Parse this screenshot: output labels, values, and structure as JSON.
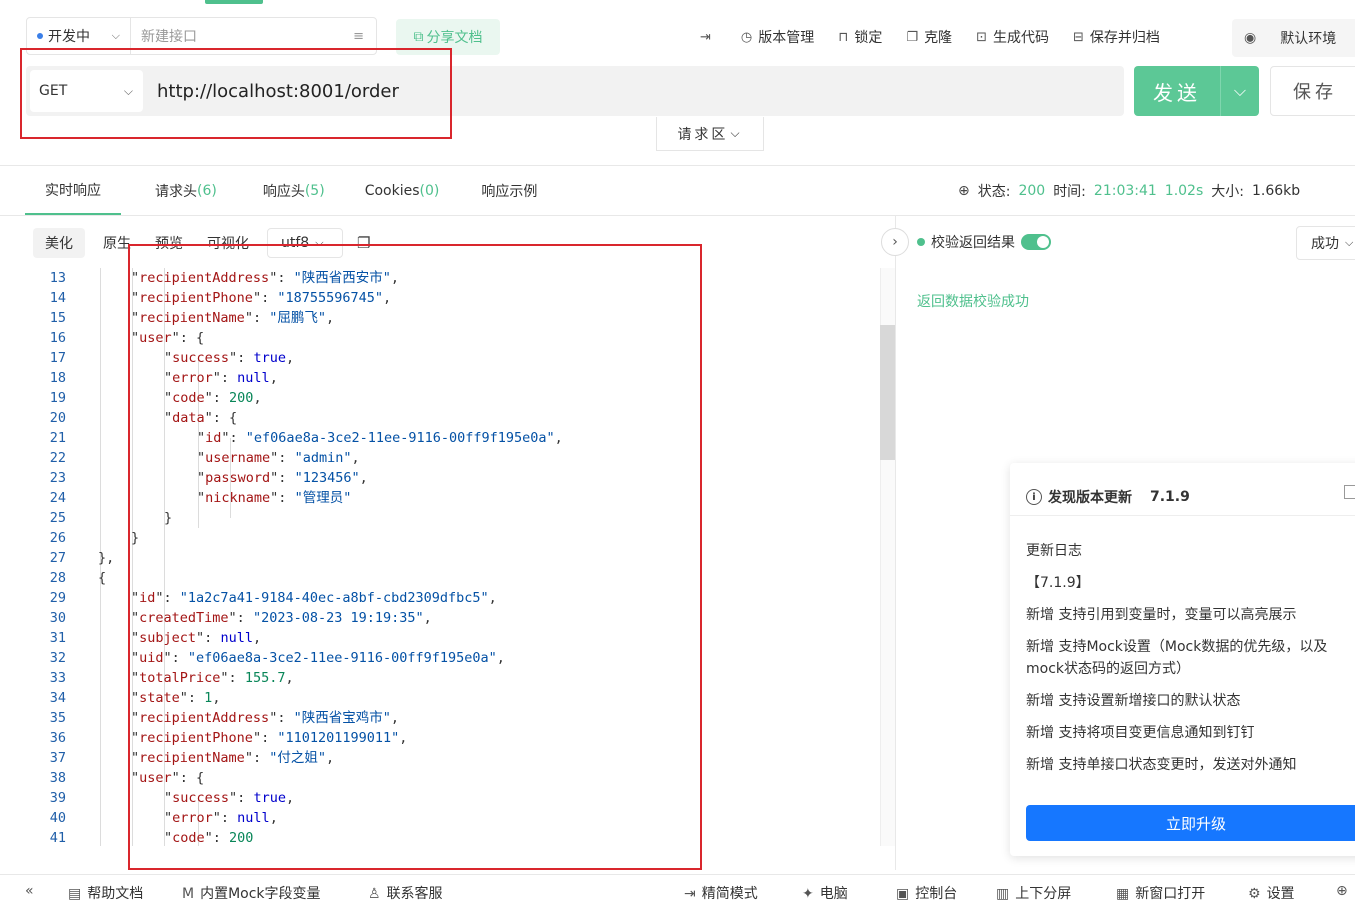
{
  "top": {
    "status": "开发中",
    "api_name_placeholder": "新建接口",
    "share": "分享文档",
    "tools": [
      {
        "icon": "indent-icon",
        "label": ""
      },
      {
        "icon": "clock-icon",
        "label": "版本管理"
      },
      {
        "icon": "lock-icon",
        "label": "锁定"
      },
      {
        "icon": "copy-icon",
        "label": "克隆"
      },
      {
        "icon": "code-icon",
        "label": "生成代码"
      },
      {
        "icon": "archive-icon",
        "label": "保存并归档"
      }
    ],
    "env": "默认环境"
  },
  "request": {
    "method": "GET",
    "url": "http://localhost:8001/order",
    "send": "发送",
    "save": "保存",
    "zone": "请求区"
  },
  "tabs": [
    {
      "label": "实时响应",
      "count": ""
    },
    {
      "label": "请求头",
      "count": "(6)"
    },
    {
      "label": "响应头",
      "count": "(5)"
    },
    {
      "label": "Cookies",
      "count": "(0)"
    },
    {
      "label": "响应示例",
      "count": ""
    }
  ],
  "status_line": {
    "status_label": "状态:",
    "status": "200",
    "time_label": "时间:",
    "time": "21:03:41",
    "duration": "1.02s",
    "size_label": "大小:",
    "size": "1.66kb"
  },
  "subtabs": [
    "美化",
    "原生",
    "预览",
    "可视化"
  ],
  "encoding": "utf8",
  "code_lines": [
    {
      "n": "13",
      "indent": 4,
      "k": "recipientAddress",
      "v": "\"陕西省西安市\"",
      "t": "s",
      "tail": ","
    },
    {
      "n": "14",
      "indent": 4,
      "k": "recipientPhone",
      "v": "\"18755596745\"",
      "t": "s",
      "tail": ","
    },
    {
      "n": "15",
      "indent": 4,
      "k": "recipientName",
      "v": "\"屈鹏飞\"",
      "t": "s",
      "tail": ","
    },
    {
      "n": "16",
      "indent": 4,
      "k": "user",
      "v": "{",
      "t": "p",
      "tail": ""
    },
    {
      "n": "17",
      "indent": 5,
      "k": "success",
      "v": "true",
      "t": "b",
      "tail": ","
    },
    {
      "n": "18",
      "indent": 5,
      "k": "error",
      "v": "null",
      "t": "b",
      "tail": ","
    },
    {
      "n": "19",
      "indent": 5,
      "k": "code",
      "v": "200",
      "t": "v",
      "tail": ","
    },
    {
      "n": "20",
      "indent": 5,
      "k": "data",
      "v": "{",
      "t": "p",
      "tail": ""
    },
    {
      "n": "21",
      "indent": 6,
      "k": "id",
      "v": "\"ef06ae8a-3ce2-11ee-9116-00ff9f195e0a\"",
      "t": "s",
      "tail": ","
    },
    {
      "n": "22",
      "indent": 6,
      "k": "username",
      "v": "\"admin\"",
      "t": "s",
      "tail": ","
    },
    {
      "n": "23",
      "indent": 6,
      "k": "password",
      "v": "\"123456\"",
      "t": "s",
      "tail": ","
    },
    {
      "n": "24",
      "indent": 6,
      "k": "nickname",
      "v": "\"管理员\"",
      "t": "s",
      "tail": ""
    },
    {
      "n": "25",
      "indent": 5,
      "k": "",
      "v": "}",
      "t": "p",
      "tail": ""
    },
    {
      "n": "26",
      "indent": 4,
      "k": "",
      "v": "}",
      "t": "p",
      "tail": ""
    },
    {
      "n": "27",
      "indent": 3,
      "k": "",
      "v": "},",
      "t": "p",
      "tail": ""
    },
    {
      "n": "28",
      "indent": 3,
      "k": "",
      "v": "{",
      "t": "p",
      "tail": ""
    },
    {
      "n": "29",
      "indent": 4,
      "k": "id",
      "v": "\"1a2c7a41-9184-40ec-a8bf-cbd2309dfbc5\"",
      "t": "s",
      "tail": ","
    },
    {
      "n": "30",
      "indent": 4,
      "k": "createdTime",
      "v": "\"2023-08-23 19:19:35\"",
      "t": "s",
      "tail": ","
    },
    {
      "n": "31",
      "indent": 4,
      "k": "subject",
      "v": "null",
      "t": "b",
      "tail": ","
    },
    {
      "n": "32",
      "indent": 4,
      "k": "uid",
      "v": "\"ef06ae8a-3ce2-11ee-9116-00ff9f195e0a\"",
      "t": "s",
      "tail": ","
    },
    {
      "n": "33",
      "indent": 4,
      "k": "totalPrice",
      "v": "155.7",
      "t": "v",
      "tail": ","
    },
    {
      "n": "34",
      "indent": 4,
      "k": "state",
      "v": "1",
      "t": "v",
      "tail": ","
    },
    {
      "n": "35",
      "indent": 4,
      "k": "recipientAddress",
      "v": "\"陕西省宝鸡市\"",
      "t": "s",
      "tail": ","
    },
    {
      "n": "36",
      "indent": 4,
      "k": "recipientPhone",
      "v": "\"1101201199011\"",
      "t": "s",
      "tail": ","
    },
    {
      "n": "37",
      "indent": 4,
      "k": "recipientName",
      "v": "\"付之姐\"",
      "t": "s",
      "tail": ","
    },
    {
      "n": "38",
      "indent": 4,
      "k": "user",
      "v": "{",
      "t": "p",
      "tail": ""
    },
    {
      "n": "39",
      "indent": 5,
      "k": "success",
      "v": "true",
      "t": "b",
      "tail": ","
    },
    {
      "n": "40",
      "indent": 5,
      "k": "error",
      "v": "null",
      "t": "b",
      "tail": ","
    },
    {
      "n": "41",
      "indent": 5,
      "k": "code",
      "v": "200",
      "t": "v",
      "tail": ""
    }
  ],
  "verify": {
    "label": "校验返回结果",
    "result": "成功",
    "message": "返回数据校验成功"
  },
  "update": {
    "title": "发现版本更新",
    "version": "7.1.9",
    "log_title": "更新日志",
    "ver_tag": "【7.1.9】",
    "items": [
      "新增 支持引用到变量时，变量可以高亮展示",
      "新增 支持Mock设置（Mock数据的优先级，以及mock状态码的返回方式）",
      "新增 支持设置新增接口的默认状态",
      "新增 支持将项目变更信息通知到钉钉",
      "新增 支持单接口状态变更时，发送对外通知"
    ],
    "button": "立即升级"
  },
  "bottom": {
    "items": [
      {
        "icon": "collapse-icon",
        "label": ""
      },
      {
        "icon": "help-icon",
        "label": "帮助文档"
      },
      {
        "icon": "mock-icon",
        "label": "内置Mock字段变量"
      },
      {
        "icon": "user-icon",
        "label": "联系客服"
      },
      {
        "icon": "compact-icon",
        "label": "精简模式"
      },
      {
        "icon": "bug-icon",
        "label": "电脑"
      },
      {
        "icon": "console-icon",
        "label": "控制台"
      },
      {
        "icon": "split-icon",
        "label": "上下分屏"
      },
      {
        "icon": "window-icon",
        "label": "新窗口打开"
      },
      {
        "icon": "gear-icon",
        "label": "设置"
      }
    ]
  }
}
